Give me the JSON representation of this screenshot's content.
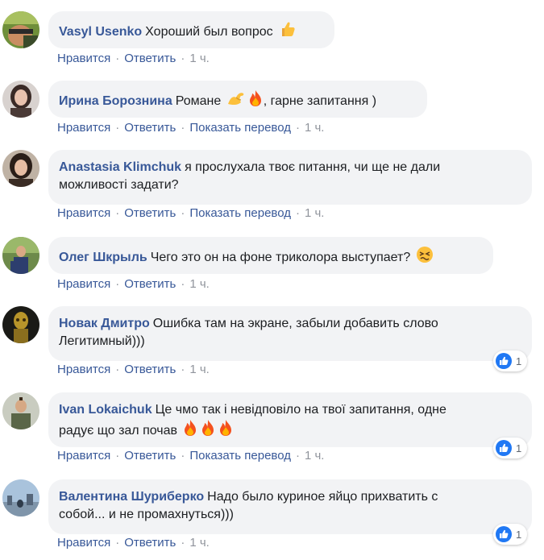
{
  "labels": {
    "like": "Нравится",
    "reply": "Ответить",
    "translate": "Показать перевод",
    "separator": "·"
  },
  "colors": {
    "author": "#385898",
    "bubble": "#f2f3f5",
    "meta": "#90949c",
    "like_blue": "#2078f4"
  },
  "comments": [
    {
      "author": "Vasyl Usenko",
      "text": "Хороший был вопрос",
      "emoji_after": [
        "thumbs-up-emoji"
      ],
      "time": "1 ч.",
      "show_translate": false,
      "reactions": null
    },
    {
      "author": "Ирина Борознина",
      "text_before": "Романе",
      "emoji_middle": [
        "flexed-biceps-emoji",
        "fire-emoji"
      ],
      "text_after": ", гарне запитання )",
      "time": "1 ч.",
      "show_translate": true,
      "reactions": null
    },
    {
      "author": "Anastasia Klimchuk",
      "text": "я прослухала твоє питання, чи ще не дали",
      "text_line2": "можливості задати?",
      "time": "1 ч.",
      "show_translate": true,
      "reactions": null
    },
    {
      "author": "Олег Шкрыль",
      "text": "Чего это он на фоне триколора выступает?",
      "emoji_after": [
        "persevering-face-emoji"
      ],
      "time": "1 ч.",
      "show_translate": false,
      "reactions": null
    },
    {
      "author": "Новак Дмитро",
      "text": "Ошибка там на экране, забыли добавить слово",
      "text_line2": "Легитимный)))",
      "time": "1 ч.",
      "show_translate": false,
      "reactions": {
        "icon": "like-icon",
        "count": "1"
      }
    },
    {
      "author": "Ivan Lokaichuk",
      "text": "Це чмо так і невідповіло на твої запитання, одне",
      "text_line2": "радує що зал почав",
      "emoji_line2": [
        "fire-emoji",
        "fire-emoji",
        "fire-emoji"
      ],
      "time": "1 ч.",
      "show_translate": true,
      "reactions": {
        "icon": "like-icon",
        "count": "1"
      }
    },
    {
      "author": "Валентина Шуриберко",
      "text": "Надо было куриное яйцо прихватить с",
      "text_line2": "собой... и не промахнуться)))",
      "time": "1 ч.",
      "show_translate": false,
      "reactions": {
        "icon": "like-icon",
        "count": "1"
      }
    }
  ]
}
